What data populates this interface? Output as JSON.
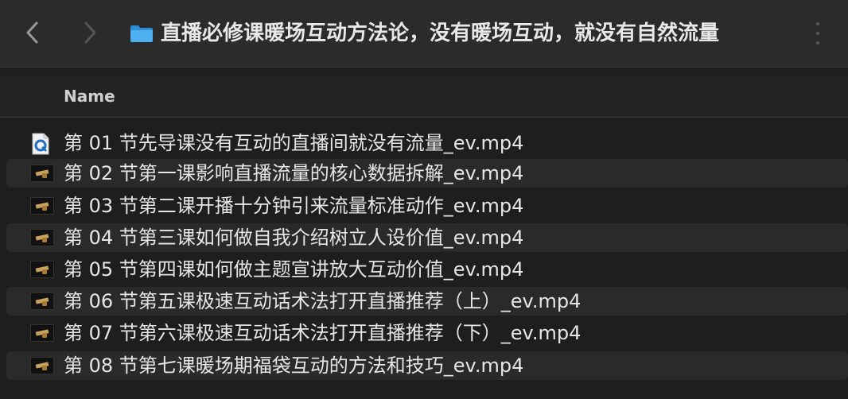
{
  "window": {
    "title": "直播必修课暖场互动方法论，没有暖场互动，就没有自然流量"
  },
  "toolbar": {
    "back_icon": "chevron-left-icon",
    "forward_icon": "chevron-right-icon",
    "folder_icon": "folder-icon",
    "folder_color": "#3aa0e8"
  },
  "columns": {
    "name": "Name"
  },
  "files": [
    {
      "name": "第 01 节先导课没有互动的直播间就没有流量_ev.mp4",
      "icon": "quicktime-document-icon"
    },
    {
      "name": "第 02 节第一课影响直播流量的核心数据拆解_ev.mp4",
      "icon": "video-thumbnail-icon"
    },
    {
      "name": "第 03 节第二课开播十分钟引来流量标准动作_ev.mp4",
      "icon": "video-thumbnail-icon"
    },
    {
      "name": "第 04 节第三课如何做自我介绍树立人设价值_ev.mp4",
      "icon": "video-thumbnail-icon"
    },
    {
      "name": "第 05 节第四课如何做主题宣讲放大互动价值_ev.mp4",
      "icon": "video-thumbnail-icon"
    },
    {
      "name": "第 06 节第五课极速互动话术法打开直播推荐（上）_ev.mp4",
      "icon": "video-thumbnail-icon"
    },
    {
      "name": "第 07 节第六课极速互动话术法打开直播推荐（下）_ev.mp4",
      "icon": "video-thumbnail-icon"
    },
    {
      "name": "第 08 节第七课暖场期福袋互动的方法和技巧_ev.mp4",
      "icon": "video-thumbnail-icon"
    }
  ]
}
